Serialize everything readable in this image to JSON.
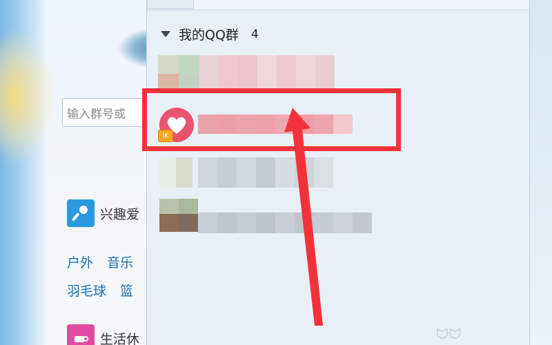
{
  "left": {
    "search_placeholder": "输入群号或",
    "categories": [
      {
        "name": "兴趣爱",
        "icon": "microphone-icon",
        "color": "#2a9ae0"
      },
      {
        "name": "生活休",
        "icon": "teacup-icon",
        "color": "#e04aa0"
      }
    ],
    "tags_row1": [
      "户外",
      "音乐"
    ],
    "tags_row2": [
      "羽毛球",
      "篮"
    ]
  },
  "group": {
    "title": "我的QQ群",
    "count": "4"
  },
  "colors": {
    "highlight": "#f2323a",
    "heart": "#e9536d",
    "link": "#1e6fb3"
  }
}
